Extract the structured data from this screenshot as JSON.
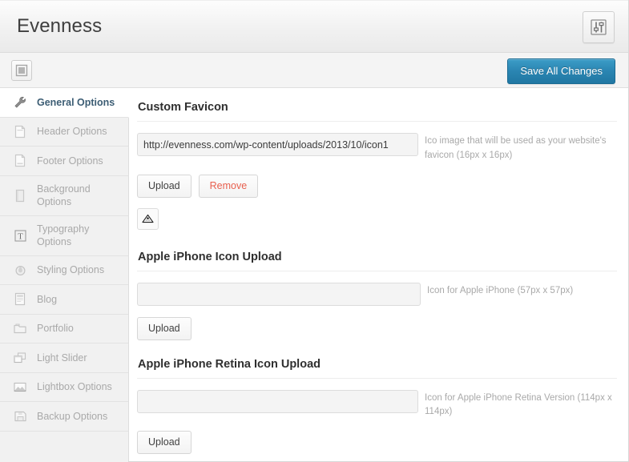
{
  "header": {
    "title": "Evenness",
    "badge_icon": "sliders-icon"
  },
  "toolbar": {
    "panel_toggle_icon": "layout-panel-icon",
    "save_label": "Save All Changes",
    "save_color": "#2a85b2"
  },
  "sidebar": {
    "items": [
      {
        "label": "General Options",
        "icon": "wrench-icon",
        "active": true
      },
      {
        "label": "Header Options",
        "icon": "document-icon",
        "active": false
      },
      {
        "label": "Footer Options",
        "icon": "document-alt-icon",
        "active": false
      },
      {
        "label": "Background Options",
        "icon": "page-icon",
        "active": false
      },
      {
        "label": "Typography Options",
        "icon": "text-t-icon",
        "active": false
      },
      {
        "label": "Styling Options",
        "icon": "paint-bucket-icon",
        "active": false
      },
      {
        "label": "Blog",
        "icon": "newspaper-icon",
        "active": false
      },
      {
        "label": "Portfolio",
        "icon": "folder-icon",
        "active": false
      },
      {
        "label": "Light Slider",
        "icon": "windows-icon",
        "active": false
      },
      {
        "label": "Lightbox Options",
        "icon": "image-icon",
        "active": false
      },
      {
        "label": "Backup Options",
        "icon": "floppy-disk-icon",
        "active": false
      }
    ]
  },
  "sections": {
    "favicon": {
      "title": "Custom Favicon",
      "input_value": "http://evenness.com/wp-content/uploads/2013/10/icon1",
      "input_placeholder": "",
      "description": "Ico image that will be used as your website's favicon (16px x 16px)",
      "upload_label": "Upload",
      "remove_label": "Remove",
      "thumbnail_icon": "favicon-thumbnail-icon"
    },
    "iphone_icon": {
      "title": "Apple iPhone Icon Upload",
      "input_value": "",
      "input_placeholder": "",
      "description": "Icon for Apple iPhone (57px x 57px)",
      "upload_label": "Upload"
    },
    "iphone_retina_icon": {
      "title": "Apple iPhone Retina Icon Upload",
      "input_value": "",
      "input_placeholder": "",
      "description": "Icon for Apple iPhone Retina Version (114px x 114px)",
      "upload_label": "Upload"
    }
  }
}
